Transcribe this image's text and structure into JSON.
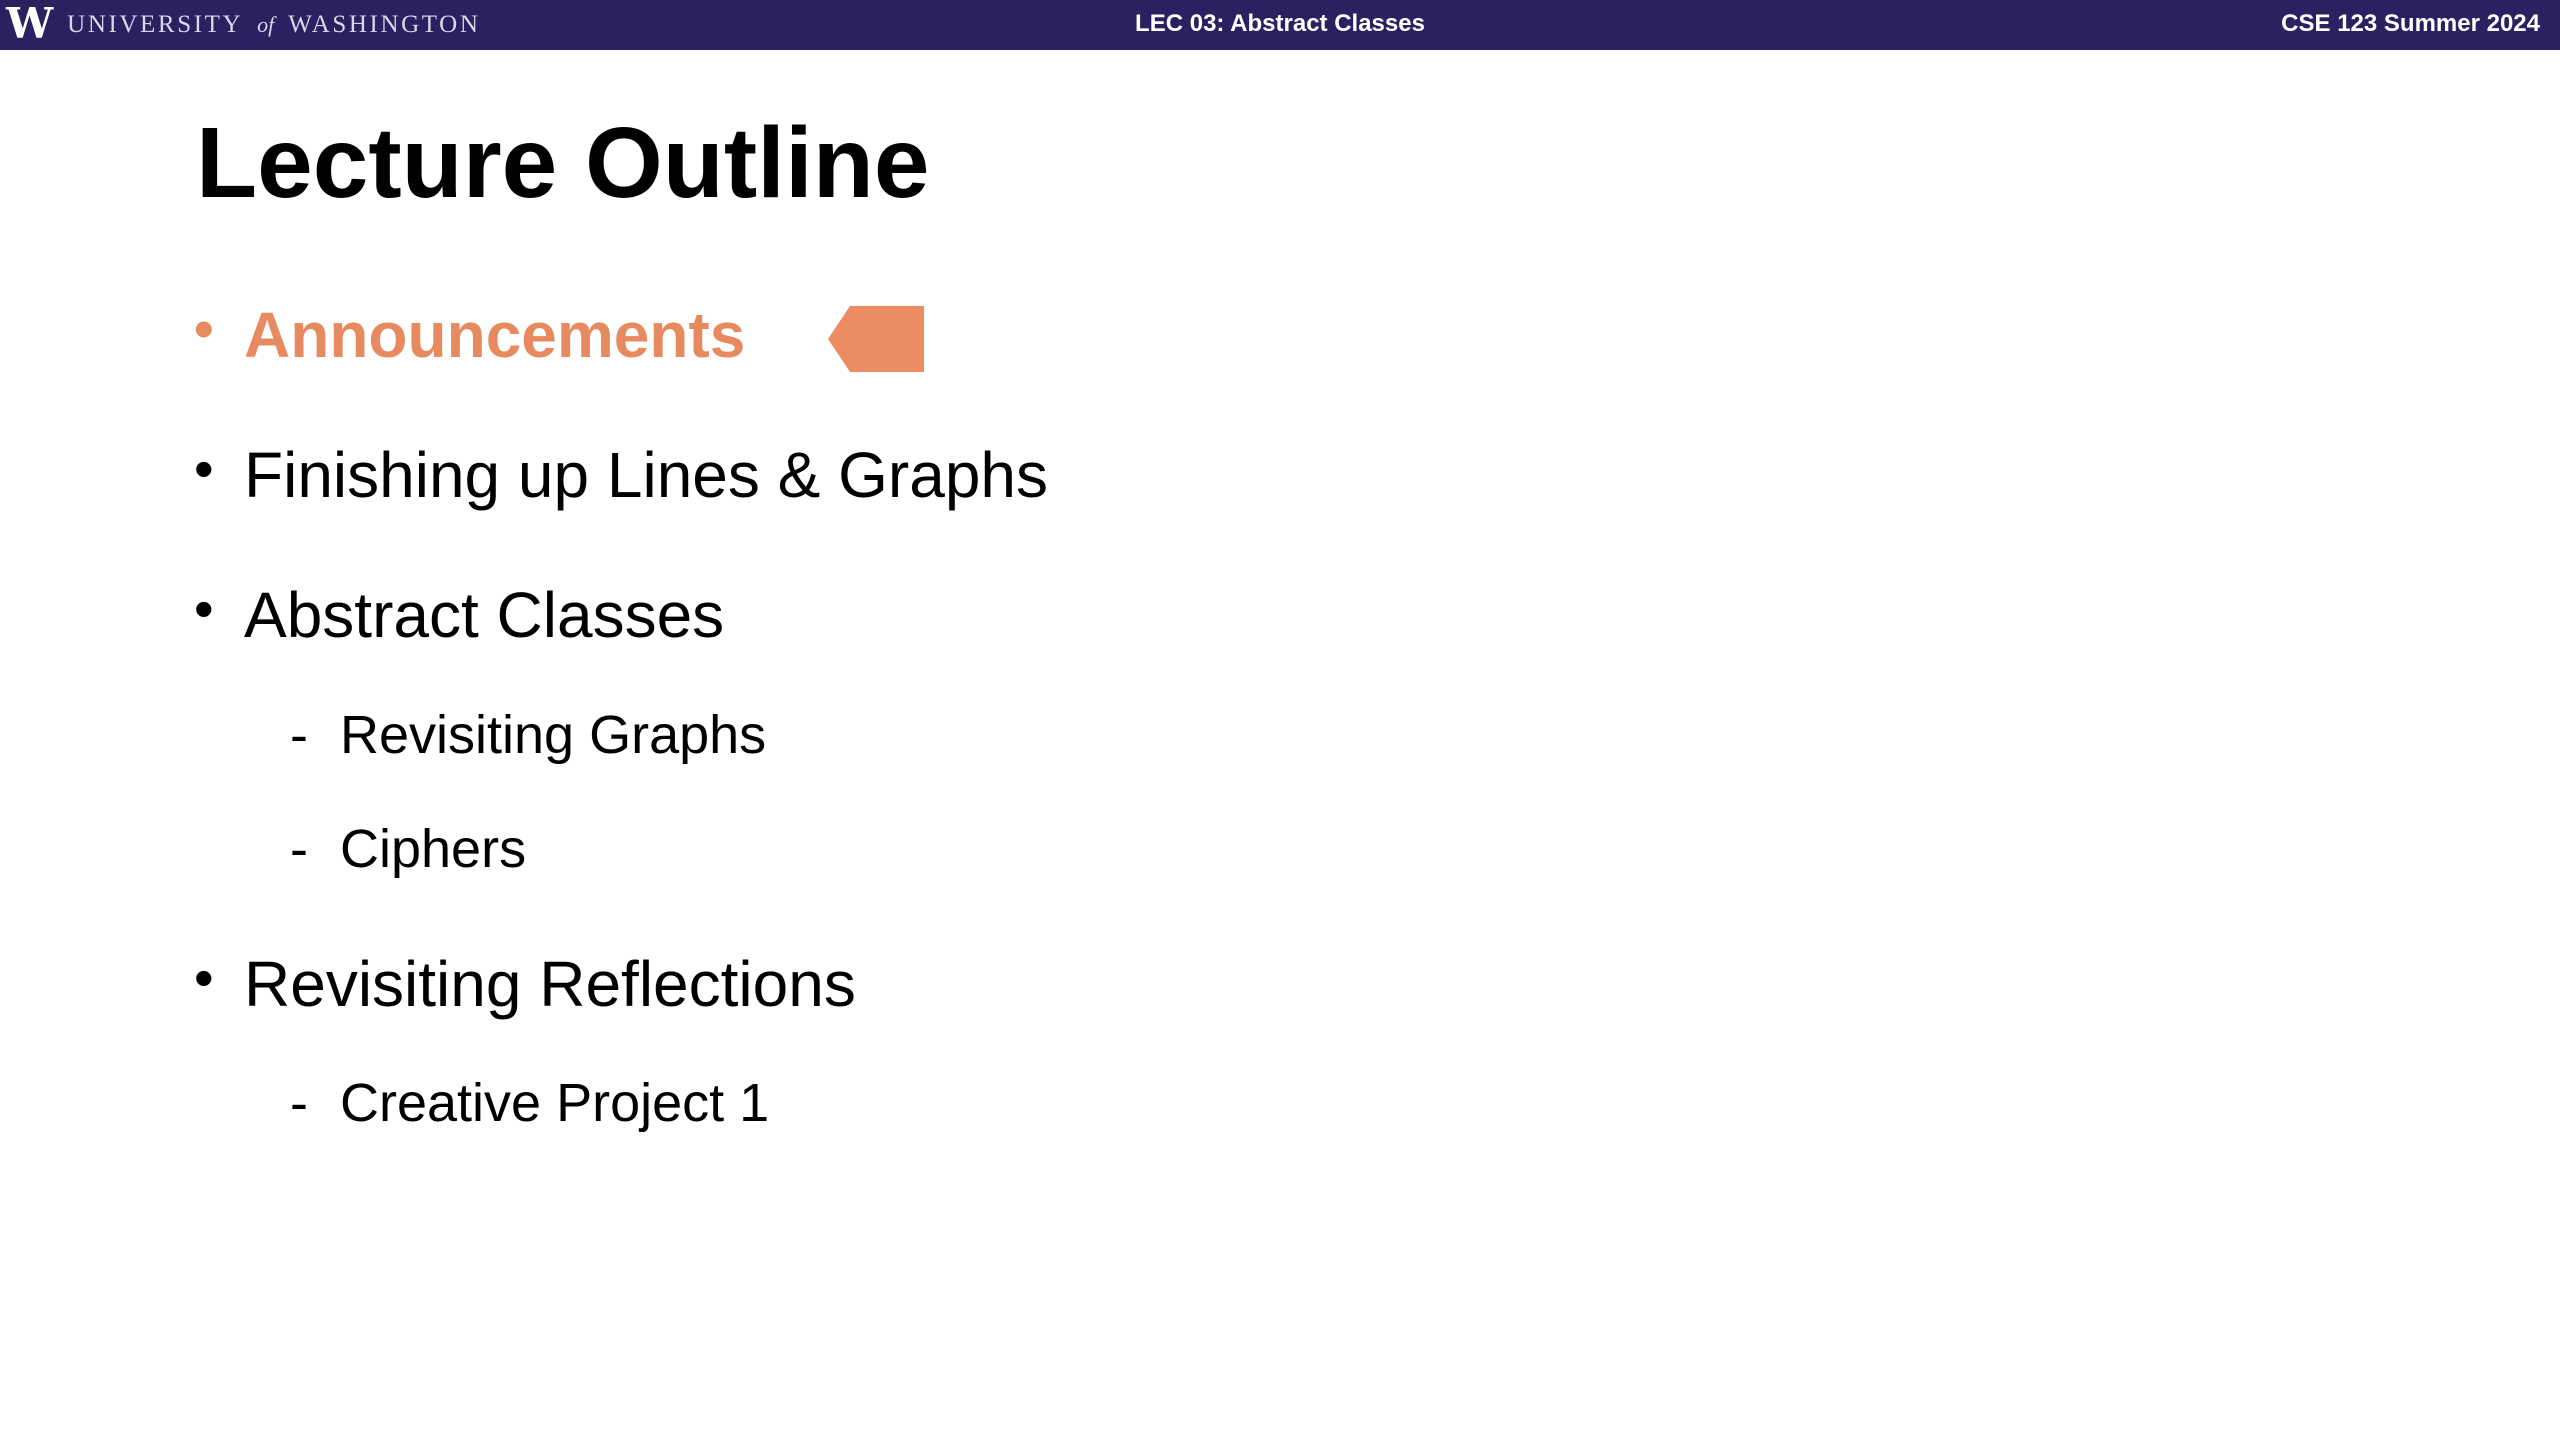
{
  "header": {
    "logo_letter": "W",
    "university_name_left": "UNIVERSITY",
    "university_name_of": "of",
    "university_name_right": "WASHINGTON",
    "lecture": "LEC 03: Abstract Classes",
    "course": "CSE 123 Summer 2024"
  },
  "slide": {
    "title": "Lecture Outline",
    "items": [
      {
        "text": "Announcements",
        "level": 1,
        "active": true
      },
      {
        "text": "Finishing up Lines & Graphs",
        "level": 1
      },
      {
        "text": "Abstract Classes",
        "level": 1
      },
      {
        "text": "Revisiting Graphs",
        "level": 2
      },
      {
        "text": "Ciphers",
        "level": 2
      },
      {
        "text": "Revisiting Reflections",
        "level": 1
      },
      {
        "text": "Creative Project 1",
        "level": 2
      }
    ],
    "bullet_glyph": "•",
    "sub_bullet_glyph": "-"
  },
  "colors": {
    "header_bg": "#2b2160",
    "accent": "#e88a5f",
    "text": "#000000"
  },
  "icons": {
    "current_item_pointer": "pentagon-arrow-left-icon"
  }
}
